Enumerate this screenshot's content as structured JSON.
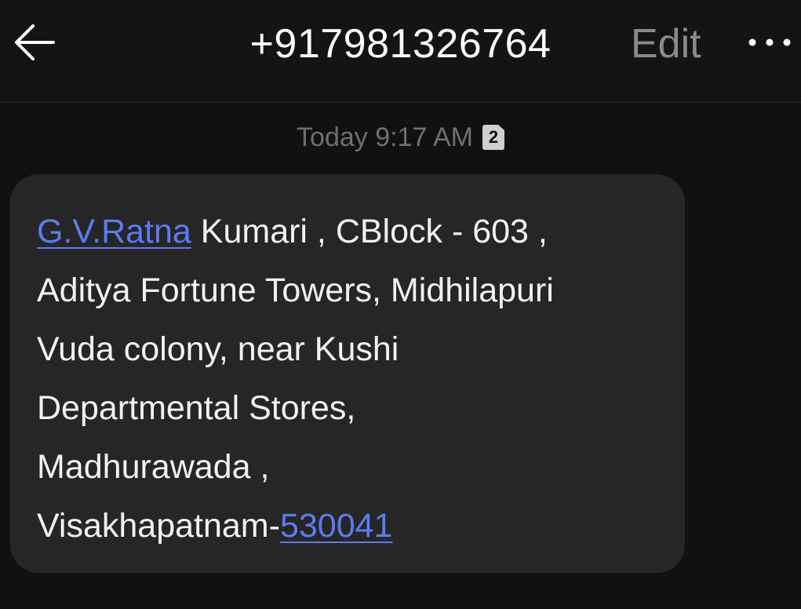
{
  "header": {
    "title": "+917981326764",
    "edit_label": "Edit",
    "back_icon": "arrow-left-icon",
    "more_icon": "more-horizontal-icon"
  },
  "conversation": {
    "timestamp": "Today 9:17 AM",
    "sim_label": "2"
  },
  "message": {
    "line1_link": "G.V.Ratna",
    "line1_rest": " Kumari , CBlock - 603 ,",
    "line2": "Aditya Fortune Towers, Midhilapuri",
    "line3": "Vuda colony, near Kushi",
    "line4": "Departmental Stores,",
    "line5": "Madhurawada ,",
    "line6_text": "Visakhapatnam-",
    "line6_link": "530041"
  },
  "colors": {
    "background": "#111111",
    "bubble": "#262626",
    "link": "#5b7cf0",
    "muted": "#8a8a8a"
  }
}
